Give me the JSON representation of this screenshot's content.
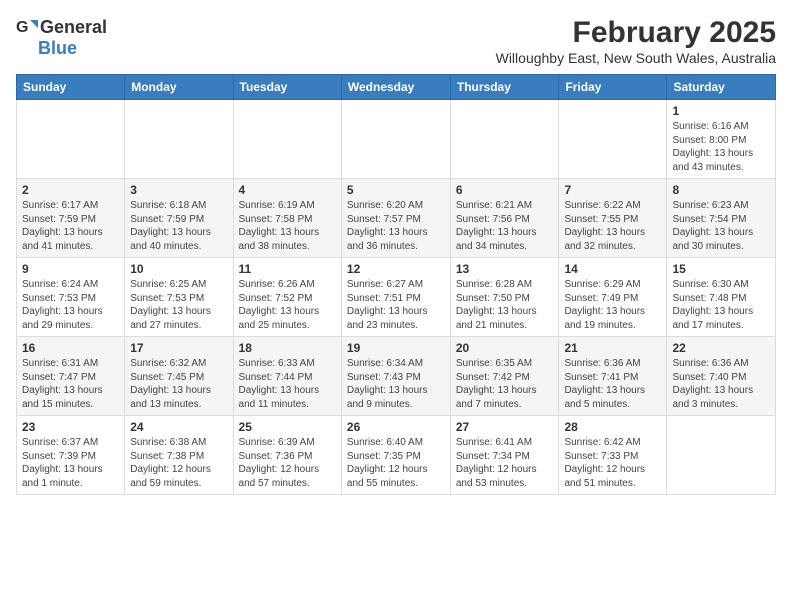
{
  "logo": {
    "general": "General",
    "blue": "Blue"
  },
  "title": "February 2025",
  "subtitle": "Willoughby East, New South Wales, Australia",
  "days_of_week": [
    "Sunday",
    "Monday",
    "Tuesday",
    "Wednesday",
    "Thursday",
    "Friday",
    "Saturday"
  ],
  "weeks": [
    [
      {
        "day": "",
        "info": ""
      },
      {
        "day": "",
        "info": ""
      },
      {
        "day": "",
        "info": ""
      },
      {
        "day": "",
        "info": ""
      },
      {
        "day": "",
        "info": ""
      },
      {
        "day": "",
        "info": ""
      },
      {
        "day": "1",
        "info": "Sunrise: 6:16 AM\nSunset: 8:00 PM\nDaylight: 13 hours and 43 minutes."
      }
    ],
    [
      {
        "day": "2",
        "info": "Sunrise: 6:17 AM\nSunset: 7:59 PM\nDaylight: 13 hours and 41 minutes."
      },
      {
        "day": "3",
        "info": "Sunrise: 6:18 AM\nSunset: 7:59 PM\nDaylight: 13 hours and 40 minutes."
      },
      {
        "day": "4",
        "info": "Sunrise: 6:19 AM\nSunset: 7:58 PM\nDaylight: 13 hours and 38 minutes."
      },
      {
        "day": "5",
        "info": "Sunrise: 6:20 AM\nSunset: 7:57 PM\nDaylight: 13 hours and 36 minutes."
      },
      {
        "day": "6",
        "info": "Sunrise: 6:21 AM\nSunset: 7:56 PM\nDaylight: 13 hours and 34 minutes."
      },
      {
        "day": "7",
        "info": "Sunrise: 6:22 AM\nSunset: 7:55 PM\nDaylight: 13 hours and 32 minutes."
      },
      {
        "day": "8",
        "info": "Sunrise: 6:23 AM\nSunset: 7:54 PM\nDaylight: 13 hours and 30 minutes."
      }
    ],
    [
      {
        "day": "9",
        "info": "Sunrise: 6:24 AM\nSunset: 7:53 PM\nDaylight: 13 hours and 29 minutes."
      },
      {
        "day": "10",
        "info": "Sunrise: 6:25 AM\nSunset: 7:53 PM\nDaylight: 13 hours and 27 minutes."
      },
      {
        "day": "11",
        "info": "Sunrise: 6:26 AM\nSunset: 7:52 PM\nDaylight: 13 hours and 25 minutes."
      },
      {
        "day": "12",
        "info": "Sunrise: 6:27 AM\nSunset: 7:51 PM\nDaylight: 13 hours and 23 minutes."
      },
      {
        "day": "13",
        "info": "Sunrise: 6:28 AM\nSunset: 7:50 PM\nDaylight: 13 hours and 21 minutes."
      },
      {
        "day": "14",
        "info": "Sunrise: 6:29 AM\nSunset: 7:49 PM\nDaylight: 13 hours and 19 minutes."
      },
      {
        "day": "15",
        "info": "Sunrise: 6:30 AM\nSunset: 7:48 PM\nDaylight: 13 hours and 17 minutes."
      }
    ],
    [
      {
        "day": "16",
        "info": "Sunrise: 6:31 AM\nSunset: 7:47 PM\nDaylight: 13 hours and 15 minutes."
      },
      {
        "day": "17",
        "info": "Sunrise: 6:32 AM\nSunset: 7:45 PM\nDaylight: 13 hours and 13 minutes."
      },
      {
        "day": "18",
        "info": "Sunrise: 6:33 AM\nSunset: 7:44 PM\nDaylight: 13 hours and 11 minutes."
      },
      {
        "day": "19",
        "info": "Sunrise: 6:34 AM\nSunset: 7:43 PM\nDaylight: 13 hours and 9 minutes."
      },
      {
        "day": "20",
        "info": "Sunrise: 6:35 AM\nSunset: 7:42 PM\nDaylight: 13 hours and 7 minutes."
      },
      {
        "day": "21",
        "info": "Sunrise: 6:36 AM\nSunset: 7:41 PM\nDaylight: 13 hours and 5 minutes."
      },
      {
        "day": "22",
        "info": "Sunrise: 6:36 AM\nSunset: 7:40 PM\nDaylight: 13 hours and 3 minutes."
      }
    ],
    [
      {
        "day": "23",
        "info": "Sunrise: 6:37 AM\nSunset: 7:39 PM\nDaylight: 13 hours and 1 minute."
      },
      {
        "day": "24",
        "info": "Sunrise: 6:38 AM\nSunset: 7:38 PM\nDaylight: 12 hours and 59 minutes."
      },
      {
        "day": "25",
        "info": "Sunrise: 6:39 AM\nSunset: 7:36 PM\nDaylight: 12 hours and 57 minutes."
      },
      {
        "day": "26",
        "info": "Sunrise: 6:40 AM\nSunset: 7:35 PM\nDaylight: 12 hours and 55 minutes."
      },
      {
        "day": "27",
        "info": "Sunrise: 6:41 AM\nSunset: 7:34 PM\nDaylight: 12 hours and 53 minutes."
      },
      {
        "day": "28",
        "info": "Sunrise: 6:42 AM\nSunset: 7:33 PM\nDaylight: 12 hours and 51 minutes."
      },
      {
        "day": "",
        "info": ""
      }
    ]
  ]
}
